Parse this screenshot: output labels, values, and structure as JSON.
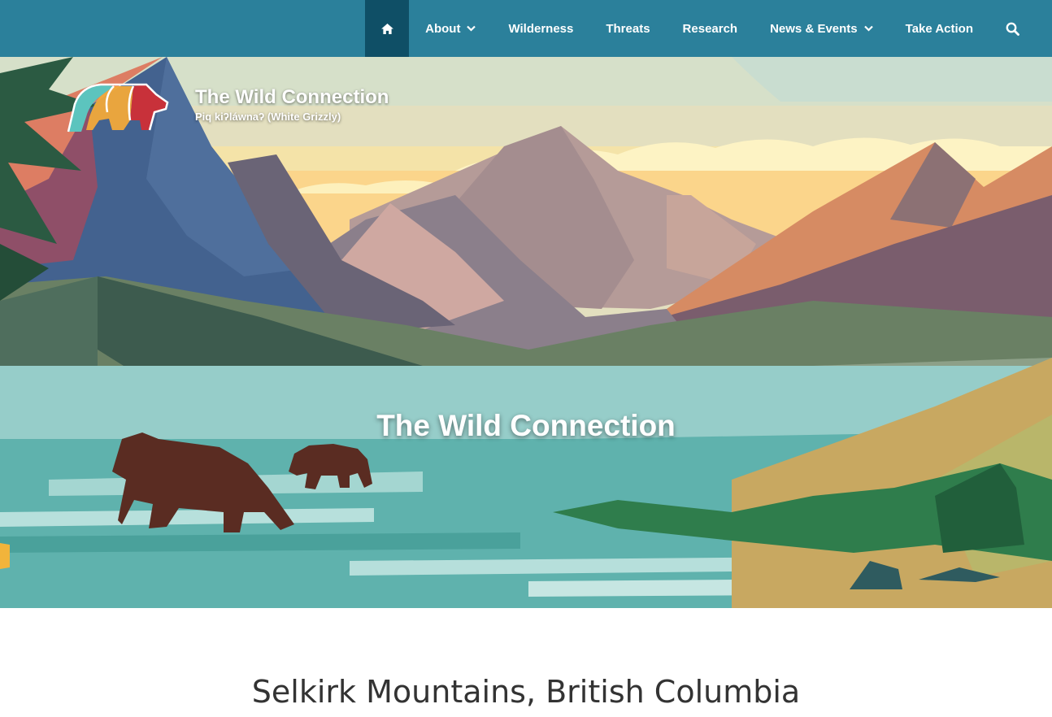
{
  "nav": {
    "home_icon": "home-icon",
    "items": [
      {
        "label": "About",
        "has_dropdown": true
      },
      {
        "label": "Wilderness",
        "has_dropdown": false
      },
      {
        "label": "Threats",
        "has_dropdown": false
      },
      {
        "label": "Research",
        "has_dropdown": false
      },
      {
        "label": "News & Events",
        "has_dropdown": true
      },
      {
        "label": "Take Action",
        "has_dropdown": false
      }
    ],
    "search_icon": "search-icon"
  },
  "brand": {
    "title": "The Wild Connection",
    "subtitle": "Piq kiʔláwnaʔ (White Grizzly)"
  },
  "hero": {
    "title": "The Wild Connection"
  },
  "section": {
    "heading": "Selkirk Mountains, British Columbia"
  },
  "colors": {
    "nav_bg": "#2b809b",
    "nav_active": "#0f4f66",
    "text_dark": "#333333"
  }
}
